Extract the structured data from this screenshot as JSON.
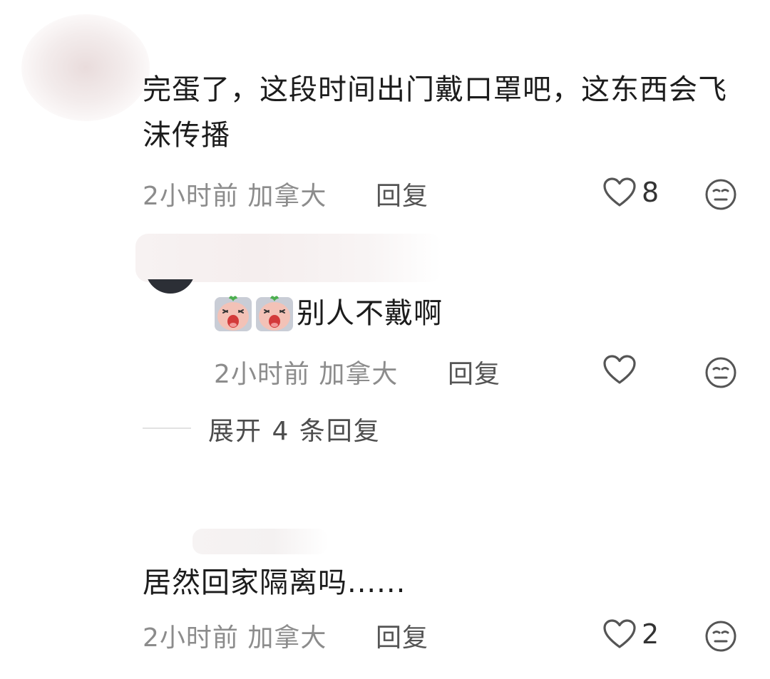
{
  "comments": [
    {
      "text": "完蛋了，这段时间出门戴口罩吧，这东西会飞沫传播",
      "meta": "2小时前 加拿大",
      "reply_label": "回复",
      "likes": "8"
    },
    {
      "text": "别人不戴啊",
      "emoji_name": "crying-radish-emoji",
      "meta": "2小时前 加拿大",
      "reply_label": "回复",
      "likes": ""
    },
    {
      "text": "居然回家隔离吗......",
      "meta": "2小时前 加拿大",
      "reply_label": "回复",
      "likes": "2"
    }
  ],
  "expand_replies_label": "展开 4 条回复",
  "colors": {
    "text": "#1c1c1c",
    "meta": "#8c8c8c",
    "icon": "#555555"
  }
}
